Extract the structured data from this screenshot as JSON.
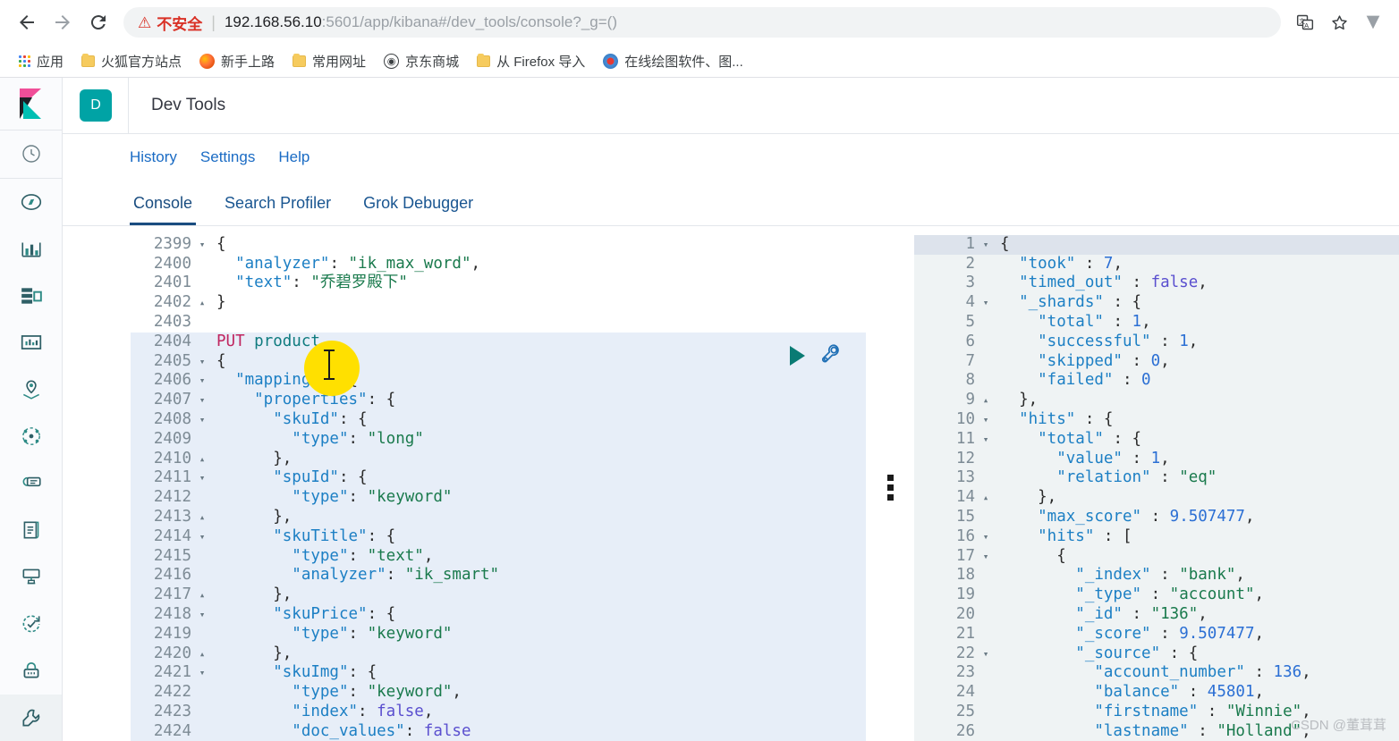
{
  "browser": {
    "back_icon": "back-arrow-icon",
    "forward_icon": "forward-arrow-icon",
    "reload_icon": "reload-icon",
    "security_warning": "不安全",
    "url_host": "192.168.56.10",
    "url_rest": ":5601/app/kibana#/dev_tools/console?_g=()",
    "translate_icon": "translate-icon",
    "bookmark_star_icon": "star-icon",
    "profile_icon": "profile-icon"
  },
  "bookmarks": [
    {
      "label": "应用",
      "icon": "apps-grid-icon"
    },
    {
      "label": "火狐官方站点",
      "icon": "folder-icon"
    },
    {
      "label": "新手上路",
      "icon": "firefox-icon"
    },
    {
      "label": "常用网址",
      "icon": "folder-icon"
    },
    {
      "label": "京东商城",
      "icon": "jd-globe-icon"
    },
    {
      "label": "从 Firefox 导入",
      "icon": "folder-icon"
    },
    {
      "label": "在线绘图软件、图...",
      "icon": "drawing-icon"
    }
  ],
  "kibana": {
    "logo": "kibana-logo",
    "app_badge": "D",
    "app_title": "Dev Tools",
    "subnav": [
      "History",
      "Settings",
      "Help"
    ],
    "tabs": [
      {
        "label": "Console",
        "active": true
      },
      {
        "label": "Search Profiler",
        "active": false
      },
      {
        "label": "Grok Debugger",
        "active": false
      }
    ],
    "sidebar": [
      "recently-viewed-icon",
      "discover-icon",
      "visualize-icon",
      "dashboard-icon",
      "canvas-icon",
      "maps-icon",
      "graph-icon",
      "machine-learning-icon",
      "logs-icon",
      "metrics-icon",
      "uptime-icon",
      "security-icon",
      "dev-tools-icon"
    ],
    "accent_color": "#00a3a5",
    "tab_active_color": "#1a4d80",
    "link_color": "#1a6bc4"
  },
  "editor": {
    "run_button_icon": "play-icon",
    "wrench_button_icon": "wrench-icon",
    "cursor_highlight_color": "#ffe000",
    "lines": [
      {
        "n": "2399",
        "fold": "▾",
        "sel": false,
        "tokens": [
          {
            "t": "{",
            "c": "punc"
          }
        ]
      },
      {
        "n": "2400",
        "fold": "",
        "sel": false,
        "tokens": [
          {
            "t": "  \"analyzer\"",
            "c": "key"
          },
          {
            "t": ": ",
            "c": "punc"
          },
          {
            "t": "\"ik_max_word\"",
            "c": "str"
          },
          {
            "t": ",",
            "c": "punc"
          }
        ]
      },
      {
        "n": "2401",
        "fold": "",
        "sel": false,
        "tokens": [
          {
            "t": "  \"text\"",
            "c": "key"
          },
          {
            "t": ": ",
            "c": "punc"
          },
          {
            "t": "\"乔碧罗殿下\"",
            "c": "cjk"
          }
        ]
      },
      {
        "n": "2402",
        "fold": "▴",
        "sel": false,
        "tokens": [
          {
            "t": "}",
            "c": "punc"
          }
        ]
      },
      {
        "n": "2403",
        "fold": "",
        "sel": false,
        "tokens": []
      },
      {
        "n": "2404",
        "fold": "",
        "sel": true,
        "tokens": [
          {
            "t": "PUT ",
            "c": "meth"
          },
          {
            "t": "product",
            "c": "url"
          }
        ]
      },
      {
        "n": "2405",
        "fold": "▾",
        "sel": true,
        "tokens": [
          {
            "t": "{",
            "c": "punc"
          }
        ]
      },
      {
        "n": "2406",
        "fold": "▾",
        "sel": true,
        "tokens": [
          {
            "t": "  \"mappings\"",
            "c": "key"
          },
          {
            "t": ": {",
            "c": "punc"
          }
        ]
      },
      {
        "n": "2407",
        "fold": "▾",
        "sel": true,
        "tokens": [
          {
            "t": "    \"properties\"",
            "c": "key"
          },
          {
            "t": ": {",
            "c": "punc"
          }
        ]
      },
      {
        "n": "2408",
        "fold": "▾",
        "sel": true,
        "tokens": [
          {
            "t": "      \"skuId\"",
            "c": "key"
          },
          {
            "t": ": {",
            "c": "punc"
          }
        ]
      },
      {
        "n": "2409",
        "fold": "",
        "sel": true,
        "tokens": [
          {
            "t": "        \"type\"",
            "c": "key"
          },
          {
            "t": ": ",
            "c": "punc"
          },
          {
            "t": "\"long\"",
            "c": "str"
          }
        ]
      },
      {
        "n": "2410",
        "fold": "▴",
        "sel": true,
        "tokens": [
          {
            "t": "      },",
            "c": "punc"
          }
        ]
      },
      {
        "n": "2411",
        "fold": "▾",
        "sel": true,
        "tokens": [
          {
            "t": "      \"spuId\"",
            "c": "key"
          },
          {
            "t": ": {",
            "c": "punc"
          }
        ]
      },
      {
        "n": "2412",
        "fold": "",
        "sel": true,
        "tokens": [
          {
            "t": "        \"type\"",
            "c": "key"
          },
          {
            "t": ": ",
            "c": "punc"
          },
          {
            "t": "\"keyword\"",
            "c": "str"
          }
        ]
      },
      {
        "n": "2413",
        "fold": "▴",
        "sel": true,
        "tokens": [
          {
            "t": "      },",
            "c": "punc"
          }
        ]
      },
      {
        "n": "2414",
        "fold": "▾",
        "sel": true,
        "tokens": [
          {
            "t": "      \"skuTitle\"",
            "c": "key"
          },
          {
            "t": ": {",
            "c": "punc"
          }
        ]
      },
      {
        "n": "2415",
        "fold": "",
        "sel": true,
        "tokens": [
          {
            "t": "        \"type\"",
            "c": "key"
          },
          {
            "t": ": ",
            "c": "punc"
          },
          {
            "t": "\"text\"",
            "c": "str"
          },
          {
            "t": ",",
            "c": "punc"
          }
        ]
      },
      {
        "n": "2416",
        "fold": "",
        "sel": true,
        "tokens": [
          {
            "t": "        \"analyzer\"",
            "c": "key"
          },
          {
            "t": ": ",
            "c": "punc"
          },
          {
            "t": "\"ik_smart\"",
            "c": "str"
          }
        ]
      },
      {
        "n": "2417",
        "fold": "▴",
        "sel": true,
        "tokens": [
          {
            "t": "      },",
            "c": "punc"
          }
        ]
      },
      {
        "n": "2418",
        "fold": "▾",
        "sel": true,
        "tokens": [
          {
            "t": "      \"skuPrice\"",
            "c": "key"
          },
          {
            "t": ": {",
            "c": "punc"
          }
        ]
      },
      {
        "n": "2419",
        "fold": "",
        "sel": true,
        "tokens": [
          {
            "t": "        \"type\"",
            "c": "key"
          },
          {
            "t": ": ",
            "c": "punc"
          },
          {
            "t": "\"keyword\"",
            "c": "str"
          }
        ]
      },
      {
        "n": "2420",
        "fold": "▴",
        "sel": true,
        "tokens": [
          {
            "t": "      },",
            "c": "punc"
          }
        ]
      },
      {
        "n": "2421",
        "fold": "▾",
        "sel": true,
        "tokens": [
          {
            "t": "      \"skuImg\"",
            "c": "key"
          },
          {
            "t": ": {",
            "c": "punc"
          }
        ]
      },
      {
        "n": "2422",
        "fold": "",
        "sel": true,
        "tokens": [
          {
            "t": "        \"type\"",
            "c": "key"
          },
          {
            "t": ": ",
            "c": "punc"
          },
          {
            "t": "\"keyword\"",
            "c": "str"
          },
          {
            "t": ",",
            "c": "punc"
          }
        ]
      },
      {
        "n": "2423",
        "fold": "",
        "sel": true,
        "tokens": [
          {
            "t": "        \"index\"",
            "c": "key"
          },
          {
            "t": ": ",
            "c": "punc"
          },
          {
            "t": "false",
            "c": "bool"
          },
          {
            "t": ",",
            "c": "punc"
          }
        ]
      },
      {
        "n": "2424",
        "fold": "",
        "sel": true,
        "tokens": [
          {
            "t": "        \"doc_values\"",
            "c": "key"
          },
          {
            "t": ": ",
            "c": "punc"
          },
          {
            "t": "false",
            "c": "bool"
          }
        ]
      }
    ]
  },
  "response": {
    "lines": [
      {
        "n": "1",
        "fold": "▾",
        "cur": true,
        "tokens": [
          {
            "t": "{",
            "c": "punc"
          }
        ]
      },
      {
        "n": "2",
        "fold": "",
        "cur": false,
        "tokens": [
          {
            "t": "  \"took\"",
            "c": "key"
          },
          {
            "t": " : ",
            "c": "punc"
          },
          {
            "t": "7",
            "c": "num"
          },
          {
            "t": ",",
            "c": "punc"
          }
        ]
      },
      {
        "n": "3",
        "fold": "",
        "cur": false,
        "tokens": [
          {
            "t": "  \"timed_out\"",
            "c": "key"
          },
          {
            "t": " : ",
            "c": "punc"
          },
          {
            "t": "false",
            "c": "bool"
          },
          {
            "t": ",",
            "c": "punc"
          }
        ]
      },
      {
        "n": "4",
        "fold": "▾",
        "cur": false,
        "tokens": [
          {
            "t": "  \"_shards\"",
            "c": "key"
          },
          {
            "t": " : {",
            "c": "punc"
          }
        ]
      },
      {
        "n": "5",
        "fold": "",
        "cur": false,
        "tokens": [
          {
            "t": "    \"total\"",
            "c": "key"
          },
          {
            "t": " : ",
            "c": "punc"
          },
          {
            "t": "1",
            "c": "num"
          },
          {
            "t": ",",
            "c": "punc"
          }
        ]
      },
      {
        "n": "6",
        "fold": "",
        "cur": false,
        "tokens": [
          {
            "t": "    \"successful\"",
            "c": "key"
          },
          {
            "t": " : ",
            "c": "punc"
          },
          {
            "t": "1",
            "c": "num"
          },
          {
            "t": ",",
            "c": "punc"
          }
        ]
      },
      {
        "n": "7",
        "fold": "",
        "cur": false,
        "tokens": [
          {
            "t": "    \"skipped\"",
            "c": "key"
          },
          {
            "t": " : ",
            "c": "punc"
          },
          {
            "t": "0",
            "c": "num"
          },
          {
            "t": ",",
            "c": "punc"
          }
        ]
      },
      {
        "n": "8",
        "fold": "",
        "cur": false,
        "tokens": [
          {
            "t": "    \"failed\"",
            "c": "key"
          },
          {
            "t": " : ",
            "c": "punc"
          },
          {
            "t": "0",
            "c": "num"
          }
        ]
      },
      {
        "n": "9",
        "fold": "▴",
        "cur": false,
        "tokens": [
          {
            "t": "  },",
            "c": "punc"
          }
        ]
      },
      {
        "n": "10",
        "fold": "▾",
        "cur": false,
        "tokens": [
          {
            "t": "  \"hits\"",
            "c": "key"
          },
          {
            "t": " : {",
            "c": "punc"
          }
        ]
      },
      {
        "n": "11",
        "fold": "▾",
        "cur": false,
        "tokens": [
          {
            "t": "    \"total\"",
            "c": "key"
          },
          {
            "t": " : {",
            "c": "punc"
          }
        ]
      },
      {
        "n": "12",
        "fold": "",
        "cur": false,
        "tokens": [
          {
            "t": "      \"value\"",
            "c": "key"
          },
          {
            "t": " : ",
            "c": "punc"
          },
          {
            "t": "1",
            "c": "num"
          },
          {
            "t": ",",
            "c": "punc"
          }
        ]
      },
      {
        "n": "13",
        "fold": "",
        "cur": false,
        "tokens": [
          {
            "t": "      \"relation\"",
            "c": "key"
          },
          {
            "t": " : ",
            "c": "punc"
          },
          {
            "t": "\"eq\"",
            "c": "str"
          }
        ]
      },
      {
        "n": "14",
        "fold": "▴",
        "cur": false,
        "tokens": [
          {
            "t": "    },",
            "c": "punc"
          }
        ]
      },
      {
        "n": "15",
        "fold": "",
        "cur": false,
        "tokens": [
          {
            "t": "    \"max_score\"",
            "c": "key"
          },
          {
            "t": " : ",
            "c": "punc"
          },
          {
            "t": "9.507477",
            "c": "num"
          },
          {
            "t": ",",
            "c": "punc"
          }
        ]
      },
      {
        "n": "16",
        "fold": "▾",
        "cur": false,
        "tokens": [
          {
            "t": "    \"hits\"",
            "c": "key"
          },
          {
            "t": " : [",
            "c": "punc"
          }
        ]
      },
      {
        "n": "17",
        "fold": "▾",
        "cur": false,
        "tokens": [
          {
            "t": "      {",
            "c": "punc"
          }
        ]
      },
      {
        "n": "18",
        "fold": "",
        "cur": false,
        "tokens": [
          {
            "t": "        \"_index\"",
            "c": "key"
          },
          {
            "t": " : ",
            "c": "punc"
          },
          {
            "t": "\"bank\"",
            "c": "str"
          },
          {
            "t": ",",
            "c": "punc"
          }
        ]
      },
      {
        "n": "19",
        "fold": "",
        "cur": false,
        "tokens": [
          {
            "t": "        \"_type\"",
            "c": "key"
          },
          {
            "t": " : ",
            "c": "punc"
          },
          {
            "t": "\"account\"",
            "c": "str"
          },
          {
            "t": ",",
            "c": "punc"
          }
        ]
      },
      {
        "n": "20",
        "fold": "",
        "cur": false,
        "tokens": [
          {
            "t": "        \"_id\"",
            "c": "key"
          },
          {
            "t": " : ",
            "c": "punc"
          },
          {
            "t": "\"136\"",
            "c": "str"
          },
          {
            "t": ",",
            "c": "punc"
          }
        ]
      },
      {
        "n": "21",
        "fold": "",
        "cur": false,
        "tokens": [
          {
            "t": "        \"_score\"",
            "c": "key"
          },
          {
            "t": " : ",
            "c": "punc"
          },
          {
            "t": "9.507477",
            "c": "num"
          },
          {
            "t": ",",
            "c": "punc"
          }
        ]
      },
      {
        "n": "22",
        "fold": "▾",
        "cur": false,
        "tokens": [
          {
            "t": "        \"_source\"",
            "c": "key"
          },
          {
            "t": " : {",
            "c": "punc"
          }
        ]
      },
      {
        "n": "23",
        "fold": "",
        "cur": false,
        "tokens": [
          {
            "t": "          \"account_number\"",
            "c": "key"
          },
          {
            "t": " : ",
            "c": "punc"
          },
          {
            "t": "136",
            "c": "num"
          },
          {
            "t": ",",
            "c": "punc"
          }
        ]
      },
      {
        "n": "24",
        "fold": "",
        "cur": false,
        "tokens": [
          {
            "t": "          \"balance\"",
            "c": "key"
          },
          {
            "t": " : ",
            "c": "punc"
          },
          {
            "t": "45801",
            "c": "num"
          },
          {
            "t": ",",
            "c": "punc"
          }
        ]
      },
      {
        "n": "25",
        "fold": "",
        "cur": false,
        "tokens": [
          {
            "t": "          \"firstname\"",
            "c": "key"
          },
          {
            "t": " : ",
            "c": "punc"
          },
          {
            "t": "\"Winnie\"",
            "c": "str"
          },
          {
            "t": ",",
            "c": "punc"
          }
        ]
      },
      {
        "n": "26",
        "fold": "",
        "cur": false,
        "tokens": [
          {
            "t": "          \"lastname\"",
            "c": "key"
          },
          {
            "t": " : ",
            "c": "punc"
          },
          {
            "t": "\"Holland\"",
            "c": "str"
          },
          {
            "t": ",",
            "c": "punc"
          }
        ]
      }
    ]
  },
  "watermark": "CSDN @董茸茸"
}
